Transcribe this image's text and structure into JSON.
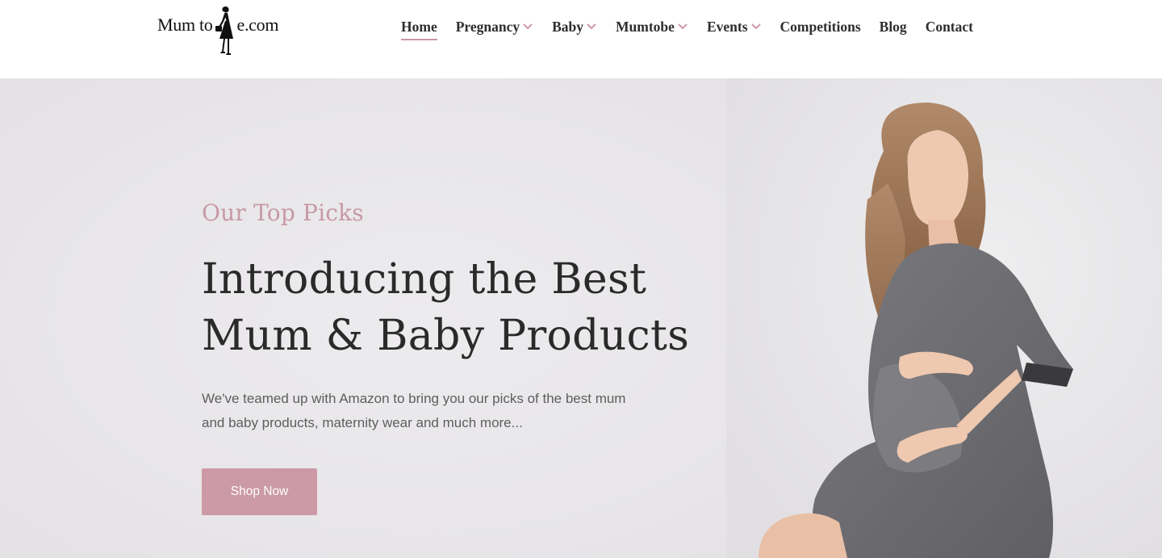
{
  "logo": {
    "text_before": "Mum to",
    "text_after": "e.com",
    "icon": "woman-silhouette-icon"
  },
  "nav": {
    "items": [
      {
        "label": "Home",
        "active": true,
        "has_dropdown": false
      },
      {
        "label": "Pregnancy",
        "active": false,
        "has_dropdown": true
      },
      {
        "label": "Baby",
        "active": false,
        "has_dropdown": true
      },
      {
        "label": "Mumtobe",
        "active": false,
        "has_dropdown": true
      },
      {
        "label": "Events",
        "active": false,
        "has_dropdown": true
      },
      {
        "label": "Competitions",
        "active": false,
        "has_dropdown": false
      },
      {
        "label": "Blog",
        "active": false,
        "has_dropdown": false
      },
      {
        "label": "Contact",
        "active": false,
        "has_dropdown": false
      }
    ],
    "dropdown_icon": "chevron-down-icon"
  },
  "hero": {
    "kicker": "Our Top Picks",
    "title_line1": "Introducing the Best",
    "title_line2": "Mum & Baby Products",
    "description_line1": "We've teamed up with Amazon to bring you our picks of the best mum",
    "description_line2": "and baby products, maternity wear and much more...",
    "button_label": "Shop Now",
    "image": "pregnant-woman-photo"
  },
  "colors": {
    "accent": "#cc9aa6",
    "kicker": "#c799a4",
    "heading": "#2a2a2a",
    "nav_text": "#2e2e2e",
    "hero_bg": "#e7e5e8"
  }
}
